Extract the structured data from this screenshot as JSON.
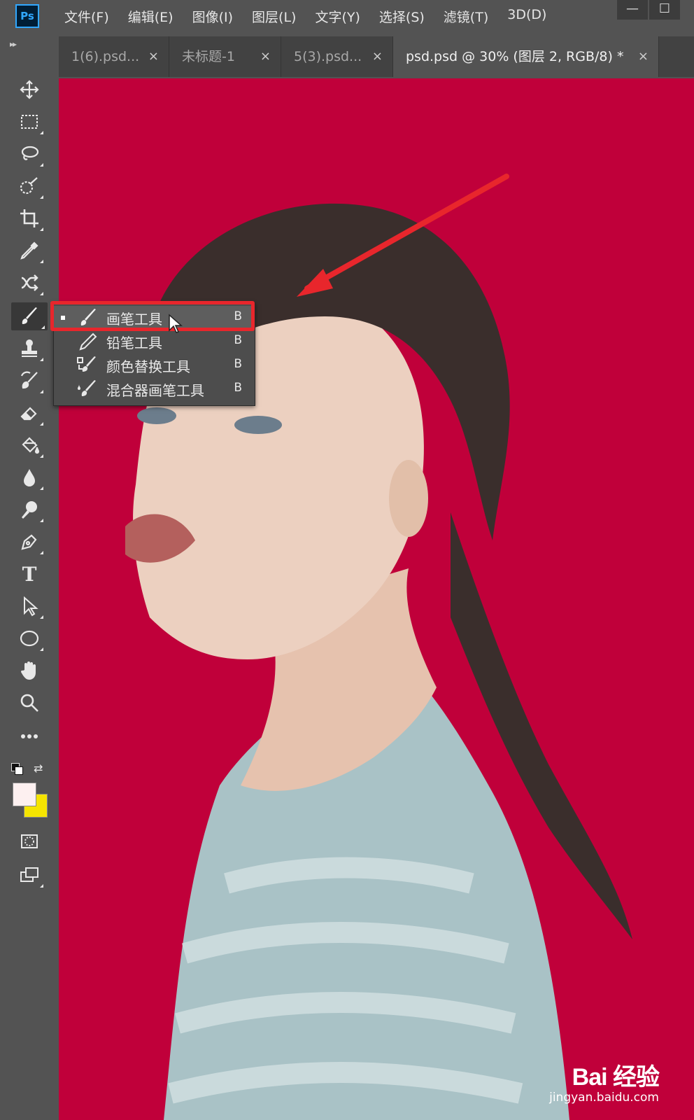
{
  "app": {
    "logo": "Ps"
  },
  "menu": [
    "文件(F)",
    "编辑(E)",
    "图像(I)",
    "图层(L)",
    "文字(Y)",
    "选择(S)",
    "滤镜(T)",
    "3D(D)"
  ],
  "window_controls": {
    "minimize": "—",
    "restore": "☐"
  },
  "tabs": [
    {
      "label": "1(6).psd...",
      "close": "×"
    },
    {
      "label": "未标题-1",
      "close": "×"
    },
    {
      "label": "5(3).psd...",
      "close": "×"
    },
    {
      "label": "psd.psd @ 30% (图层 2, RGB/8) *",
      "close": "×"
    }
  ],
  "toolbar": {
    "collapse": "▸▸",
    "tools": [
      "move-icon",
      "marquee-icon",
      "lasso-icon",
      "quick-select-icon",
      "crop-icon",
      "eyedropper-icon",
      "healing-icon",
      "brush-icon",
      "stamp-icon",
      "history-brush-icon",
      "eraser-icon",
      "paint-bucket-icon",
      "blur-icon",
      "dodge-icon",
      "pen-icon",
      "type-icon",
      "path-select-icon",
      "ellipse-icon",
      "hand-icon",
      "zoom-icon",
      "more-icon"
    ],
    "active_tool": "brush-icon",
    "type_tool_glyph": "T"
  },
  "flyout": {
    "items": [
      {
        "label": "画笔工具",
        "shortcut": "B",
        "icon": "brush-icon",
        "selected": true
      },
      {
        "label": "铅笔工具",
        "shortcut": "B",
        "icon": "pencil-icon",
        "selected": false
      },
      {
        "label": "颜色替换工具",
        "shortcut": "B",
        "icon": "color-replace-icon",
        "selected": false
      },
      {
        "label": "混合器画笔工具",
        "shortcut": "B",
        "icon": "mixer-brush-icon",
        "selected": false
      }
    ]
  },
  "colors": {
    "canvas_bg": "#c0003a",
    "foreground": "#fdf0f0",
    "background": "#f5e400",
    "highlight": "#e8262c",
    "arrow": "#e8262c"
  },
  "watermark": {
    "brand": "Bai 经验",
    "url": "jingyan.baidu.com"
  }
}
